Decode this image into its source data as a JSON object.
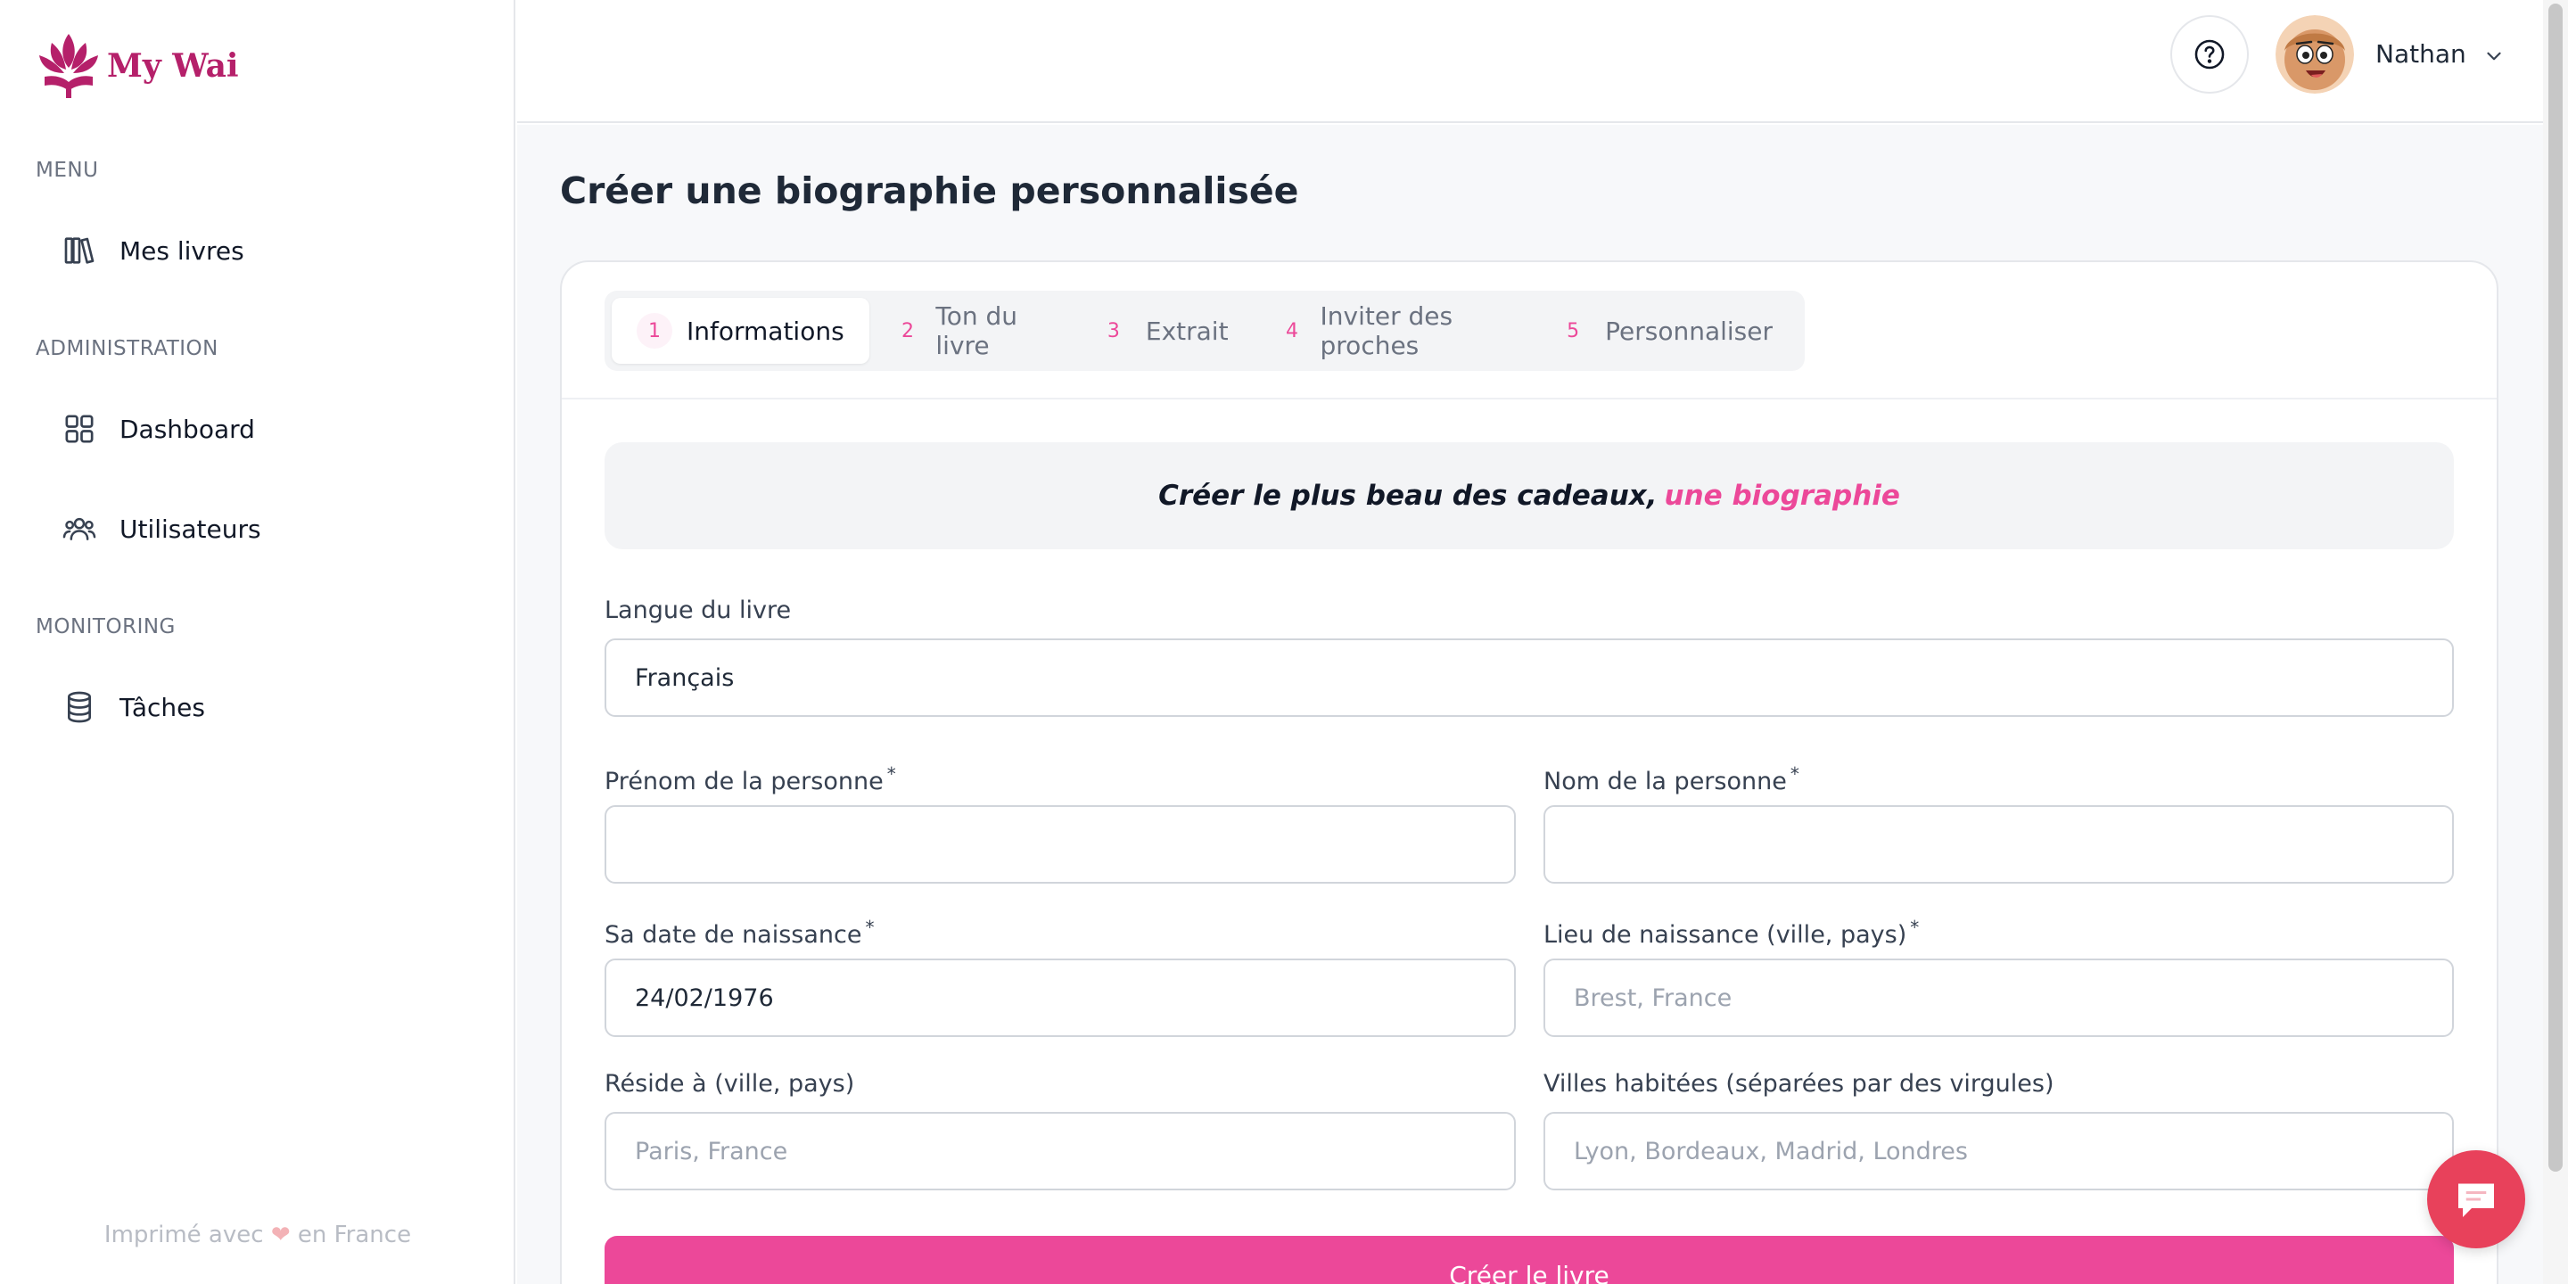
{
  "app": {
    "logo_text": "My Wai",
    "brand_color": "#b5206a",
    "accent_color": "#ec4899"
  },
  "sidebar": {
    "sections": [
      {
        "label": "MENU",
        "items": [
          {
            "label": "Mes livres",
            "icon": "books-icon"
          }
        ]
      },
      {
        "label": "ADMINISTRATION",
        "items": [
          {
            "label": "Dashboard",
            "icon": "grid-icon"
          },
          {
            "label": "Utilisateurs",
            "icon": "users-icon"
          }
        ]
      },
      {
        "label": "MONITORING",
        "items": [
          {
            "label": "Tâches",
            "icon": "database-icon"
          }
        ]
      }
    ],
    "footer": {
      "before": "Imprimé avec",
      "heart": "❤",
      "after": "en France"
    }
  },
  "header": {
    "help_icon": "question-circle-icon",
    "user_name": "Nathan"
  },
  "main": {
    "title": "Créer une biographie personnalisée",
    "steps": [
      {
        "num": "1",
        "label": "Informations",
        "active": true
      },
      {
        "num": "2",
        "label": "Ton du livre",
        "active": false
      },
      {
        "num": "3",
        "label": "Extrait",
        "active": false
      },
      {
        "num": "4",
        "label": "Inviter des proches",
        "active": false
      },
      {
        "num": "5",
        "label": "Personnaliser",
        "active": false
      }
    ],
    "banner": {
      "text": "Créer le plus beau des cadeaux,",
      "accent": "une biographie"
    },
    "form": {
      "language": {
        "label": "Langue du livre",
        "value": "Français"
      },
      "first_name": {
        "label": "Prénom de la personne",
        "required": "*",
        "value": "",
        "placeholder": ""
      },
      "last_name": {
        "label": "Nom de la personne",
        "required": "*",
        "value": "",
        "placeholder": ""
      },
      "birth_date": {
        "label": "Sa date de naissance",
        "required": "*",
        "value": "24/02/1976"
      },
      "birth_place": {
        "label": "Lieu de naissance (ville, pays)",
        "required": "*",
        "placeholder": "Brest, France"
      },
      "residence": {
        "label": "Réside à (ville, pays)",
        "placeholder": "Paris, France"
      },
      "cities": {
        "label": "Villes habitées (séparées par des virgules)",
        "placeholder": "Lyon, Bordeaux, Madrid, Londres"
      },
      "submit_label": "Créer le livre"
    }
  },
  "chat": {
    "icon": "chat-bubble-icon"
  }
}
